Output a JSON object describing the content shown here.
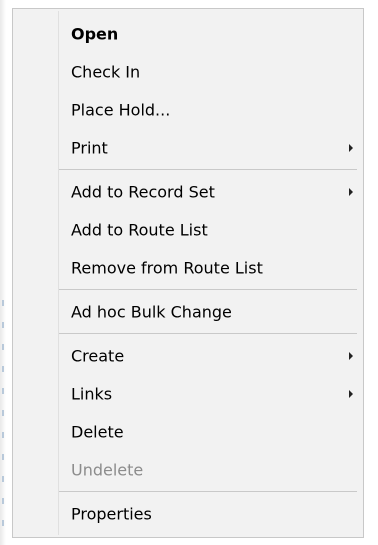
{
  "menu": {
    "items": [
      {
        "label": "Open"
      },
      {
        "label": "Check In"
      },
      {
        "label": "Place Hold..."
      },
      {
        "label": "Print"
      },
      {
        "label": "Add to Record Set"
      },
      {
        "label": "Add to Route List"
      },
      {
        "label": "Remove from Route List"
      },
      {
        "label": "Ad hoc Bulk Change"
      },
      {
        "label": "Create"
      },
      {
        "label": "Links"
      },
      {
        "label": "Delete"
      },
      {
        "label": "Undelete"
      },
      {
        "label": "Properties"
      }
    ]
  }
}
